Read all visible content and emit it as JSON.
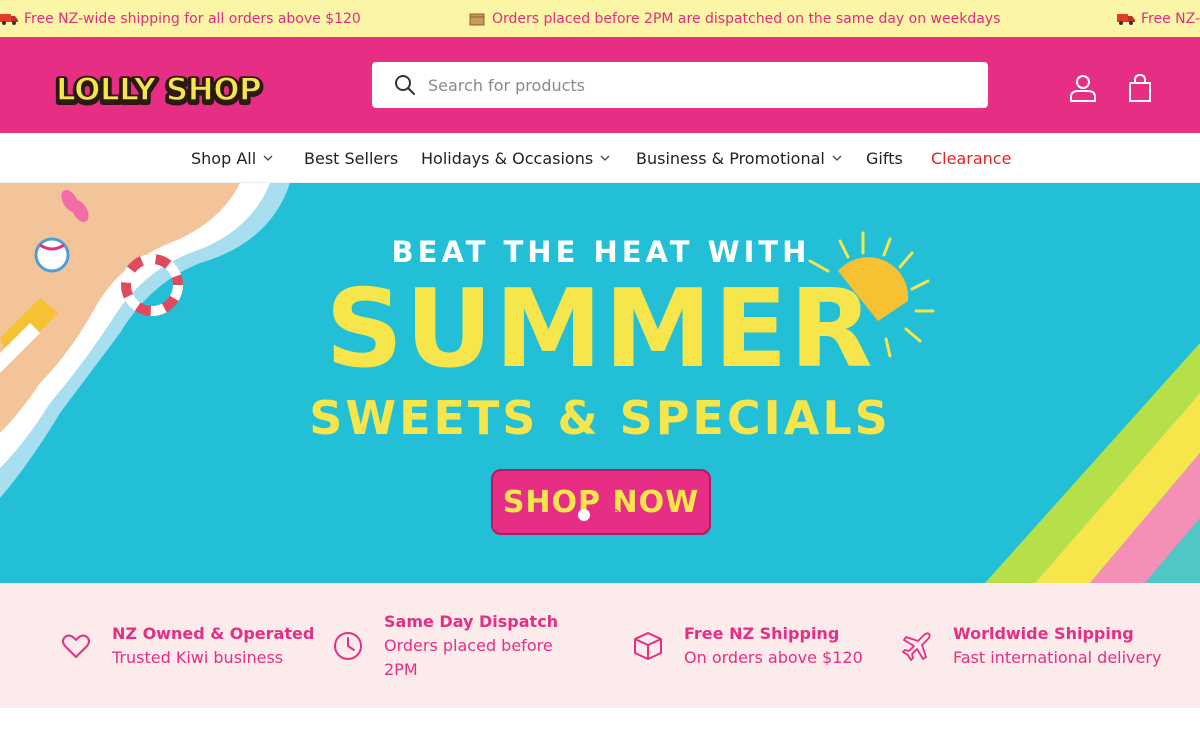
{
  "announcement": {
    "items": [
      {
        "icon": "truck-icon",
        "text": "Free NZ-wide shipping for all orders above $120"
      },
      {
        "icon": "box-icon",
        "text": "Orders placed before 2PM are dispatched on the same day on weekdays"
      },
      {
        "icon": "truck-icon",
        "text": "Free NZ-"
      }
    ]
  },
  "header": {
    "logo_text": "LOLLY SHOP",
    "search_placeholder": "Search for products",
    "account_icon": "user-icon",
    "cart_icon": "shopping-bag-icon"
  },
  "nav": {
    "items": [
      {
        "label": "Shop All",
        "dropdown": true
      },
      {
        "label": "Best Sellers",
        "dropdown": false
      },
      {
        "label": "Holidays & Occasions",
        "dropdown": true
      },
      {
        "label": "Business & Promotional",
        "dropdown": true
      },
      {
        "label": "Gifts",
        "dropdown": false
      },
      {
        "label": "Clearance",
        "dropdown": false
      }
    ]
  },
  "hero": {
    "line1": "BEAT THE HEAT WITH",
    "line2": "SUMMER",
    "line3": "SWEETS & SPECIALS",
    "button": "SHOP NOW",
    "slides": 2,
    "active_slide": 1
  },
  "features": [
    {
      "icon": "heart-icon",
      "title": "NZ Owned & Operated",
      "subtitle": "Trusted Kiwi business"
    },
    {
      "icon": "clock-icon",
      "title": "Same Day Dispatch",
      "subtitle": "Orders placed before 2PM"
    },
    {
      "icon": "package-icon",
      "title": "Free NZ Shipping",
      "subtitle": "On orders above $120"
    },
    {
      "icon": "airplane-icon",
      "title": "Worldwide Shipping",
      "subtitle": "Fast international delivery"
    }
  ],
  "colors": {
    "announce_bg": "#fbf5a6",
    "brand_pink": "#e72e85",
    "hero_bg": "#22bfd6",
    "hero_yellow": "#f6e64b",
    "clearance_red": "#e02424",
    "features_bg": "#fbeceb"
  }
}
